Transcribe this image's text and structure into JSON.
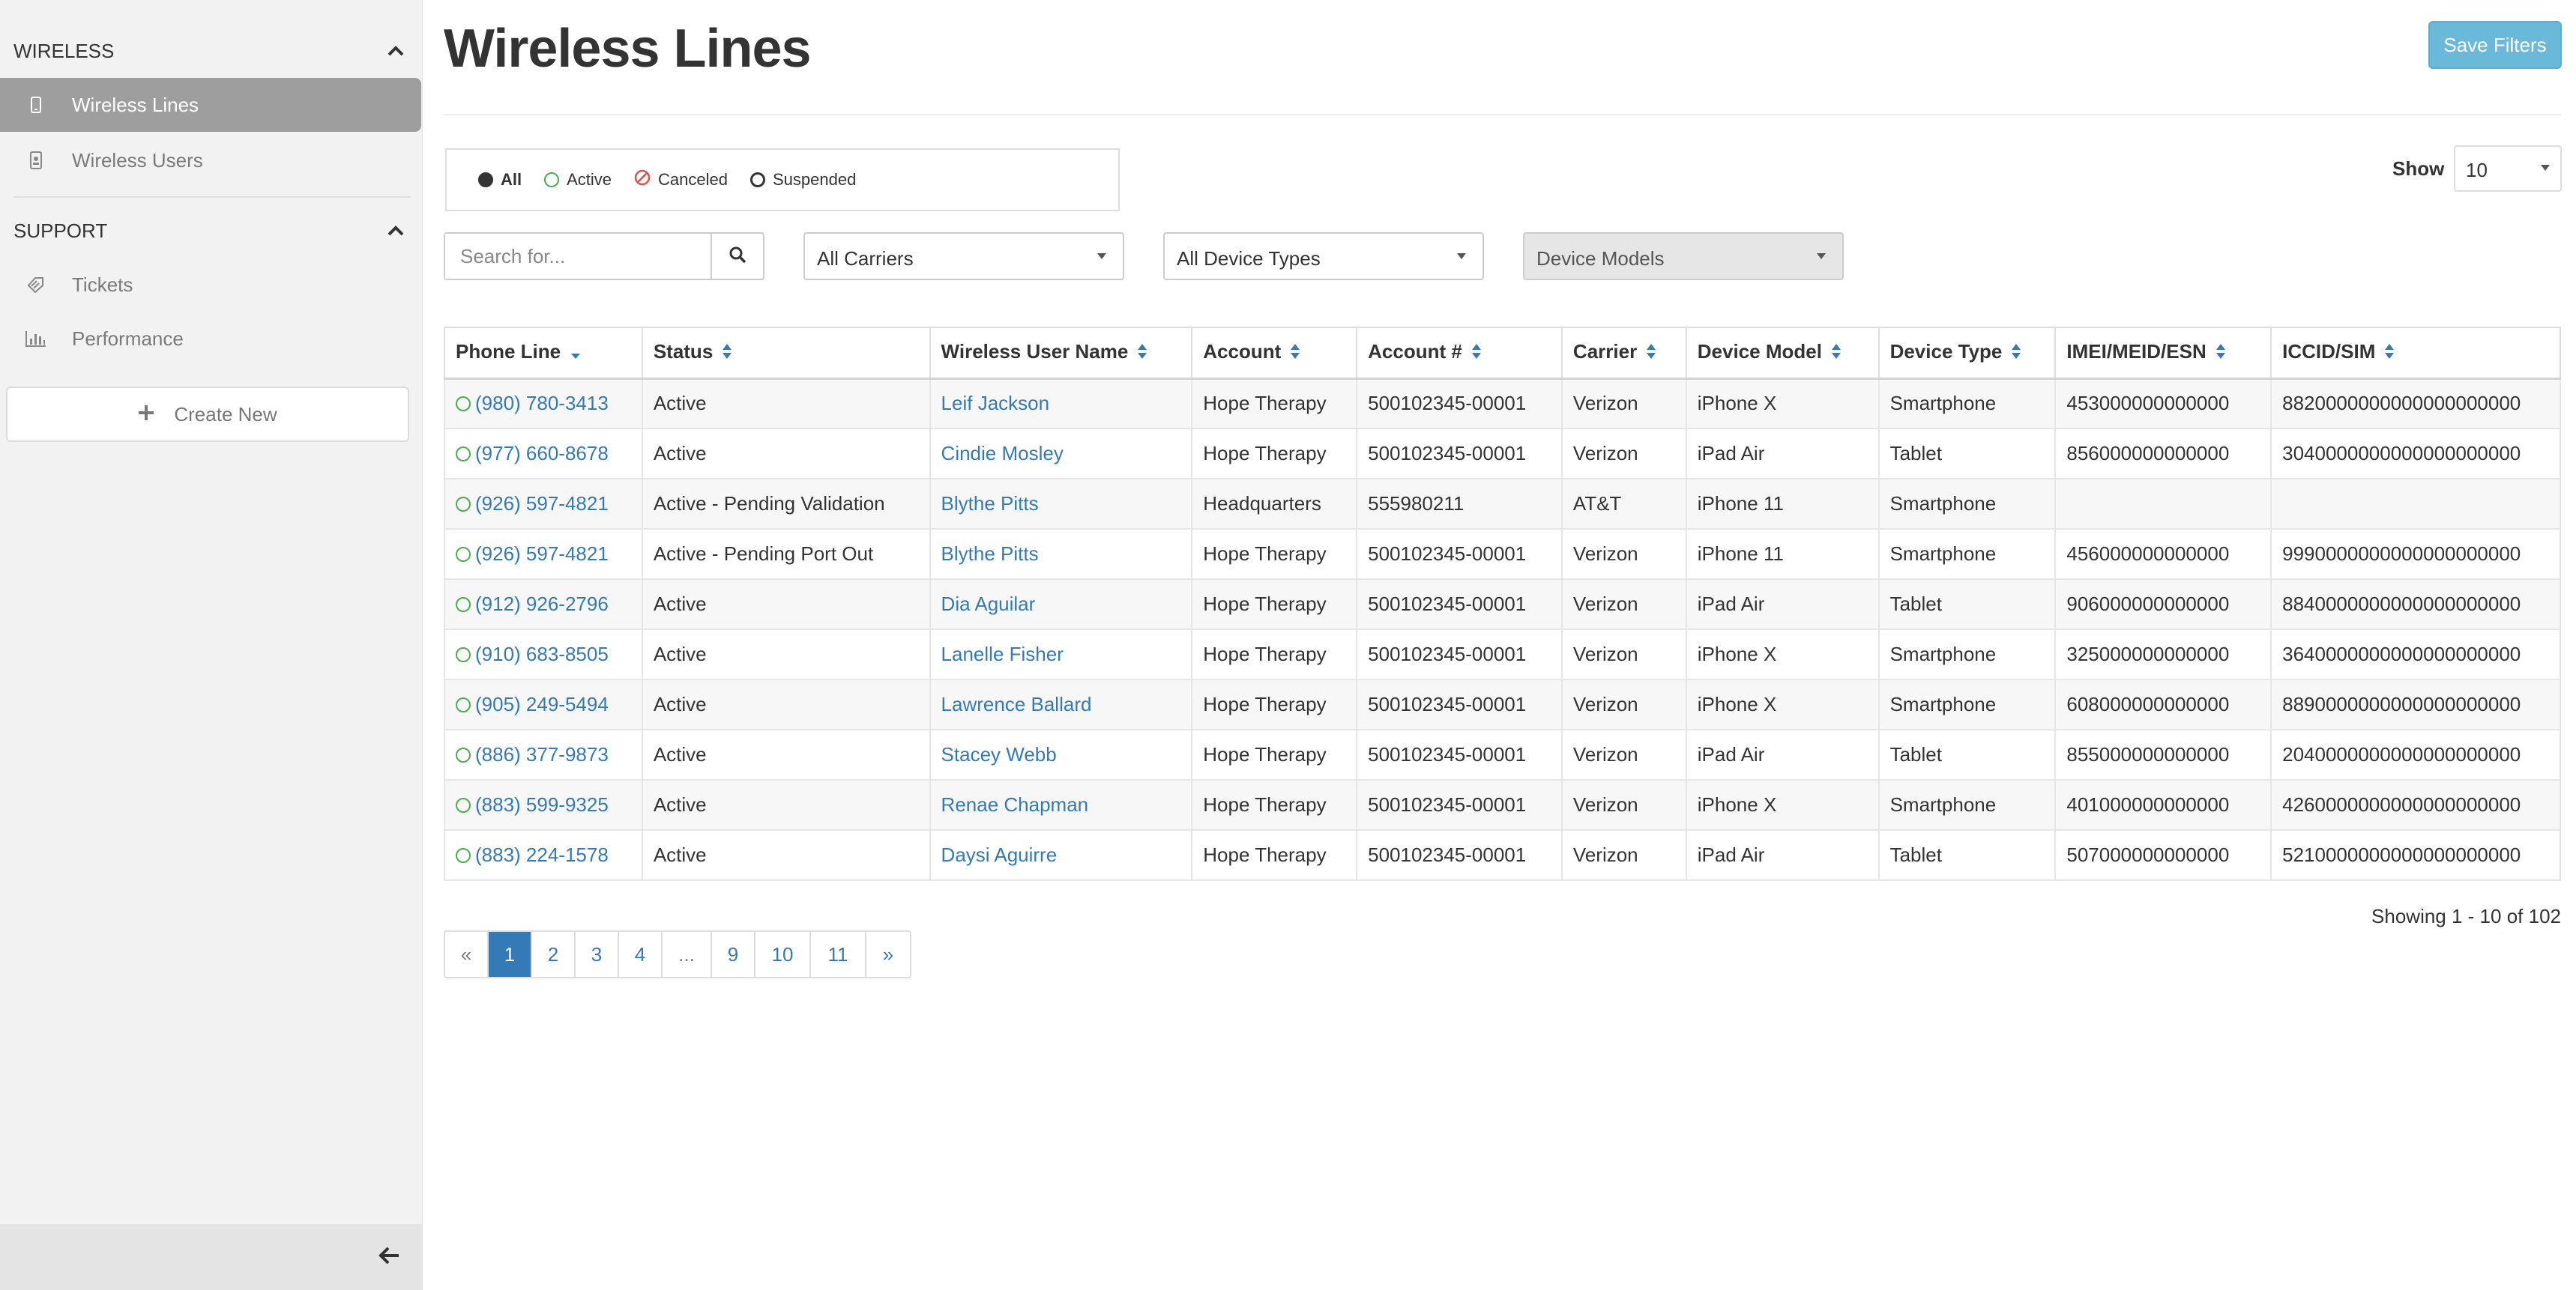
{
  "sidebar": {
    "wireless_section": "WIRELESS",
    "support_section": "SUPPORT",
    "items": [
      {
        "label": "Wireless Lines"
      },
      {
        "label": "Wireless Users"
      },
      {
        "label": "Tickets"
      },
      {
        "label": "Performance"
      }
    ],
    "create_new": "Create New"
  },
  "header": {
    "title": "Wireless Lines",
    "save_filters": "Save Filters"
  },
  "filters": {
    "status_options": [
      "All",
      "Active",
      "Canceled",
      "Suspended"
    ],
    "selected_status": "All",
    "show_label": "Show",
    "show_value": "10",
    "search_placeholder": "Search for...",
    "carriers": "All Carriers",
    "device_types": "All Device Types",
    "device_models": "Device Models"
  },
  "table": {
    "columns": [
      "Phone Line",
      "Status",
      "Wireless User Name",
      "Account",
      "Account #",
      "Carrier",
      "Device Model",
      "Device Type",
      "IMEI/MEID/ESN",
      "ICCID/SIM"
    ],
    "rows": [
      [
        "(980) 780-3413",
        "Active",
        "Leif Jackson",
        "Hope Therapy",
        "500102345-00001",
        "Verizon",
        "iPhone X",
        "Smartphone",
        "453000000000000",
        "8820000000000000000000"
      ],
      [
        "(977) 660-8678",
        "Active",
        "Cindie Mosley",
        "Hope Therapy",
        "500102345-00001",
        "Verizon",
        "iPad Air",
        "Tablet",
        "856000000000000",
        "3040000000000000000000"
      ],
      [
        "(926) 597-4821",
        "Active - Pending Validation",
        "Blythe Pitts",
        "Headquarters",
        "555980211",
        "AT&T",
        "iPhone 11",
        "Smartphone",
        "",
        ""
      ],
      [
        "(926) 597-4821",
        "Active - Pending Port Out",
        "Blythe Pitts",
        "Hope Therapy",
        "500102345-00001",
        "Verizon",
        "iPhone 11",
        "Smartphone",
        "456000000000000",
        "9990000000000000000000"
      ],
      [
        "(912) 926-2796",
        "Active",
        "Dia Aguilar",
        "Hope Therapy",
        "500102345-00001",
        "Verizon",
        "iPad Air",
        "Tablet",
        "906000000000000",
        "8840000000000000000000"
      ],
      [
        "(910) 683-8505",
        "Active",
        "Lanelle Fisher",
        "Hope Therapy",
        "500102345-00001",
        "Verizon",
        "iPhone X",
        "Smartphone",
        "325000000000000",
        "3640000000000000000000"
      ],
      [
        "(905) 249-5494",
        "Active",
        "Lawrence Ballard",
        "Hope Therapy",
        "500102345-00001",
        "Verizon",
        "iPhone X",
        "Smartphone",
        "608000000000000",
        "8890000000000000000000"
      ],
      [
        "(886) 377-9873",
        "Active",
        "Stacey Webb",
        "Hope Therapy",
        "500102345-00001",
        "Verizon",
        "iPad Air",
        "Tablet",
        "855000000000000",
        "2040000000000000000000"
      ],
      [
        "(883) 599-9325",
        "Active",
        "Renae Chapman",
        "Hope Therapy",
        "500102345-00001",
        "Verizon",
        "iPhone X",
        "Smartphone",
        "401000000000000",
        "4260000000000000000000"
      ],
      [
        "(883) 224-1578",
        "Active",
        "Daysi Aguirre",
        "Hope Therapy",
        "500102345-00001",
        "Verizon",
        "iPad Air",
        "Tablet",
        "507000000000000",
        "5210000000000000000000"
      ]
    ]
  },
  "footer": {
    "showing": "Showing 1 - 10 of 102",
    "pages": [
      "«",
      "1",
      "2",
      "3",
      "4",
      "...",
      "9",
      "10",
      "11",
      "»"
    ],
    "current_page": "1"
  },
  "colors": {
    "accent": "#337ab7",
    "save_button": "#6bb9d9",
    "active_status": "#4cae4c",
    "canceled_status": "#d9534f",
    "sidebar_active": "#9e9e9e"
  }
}
